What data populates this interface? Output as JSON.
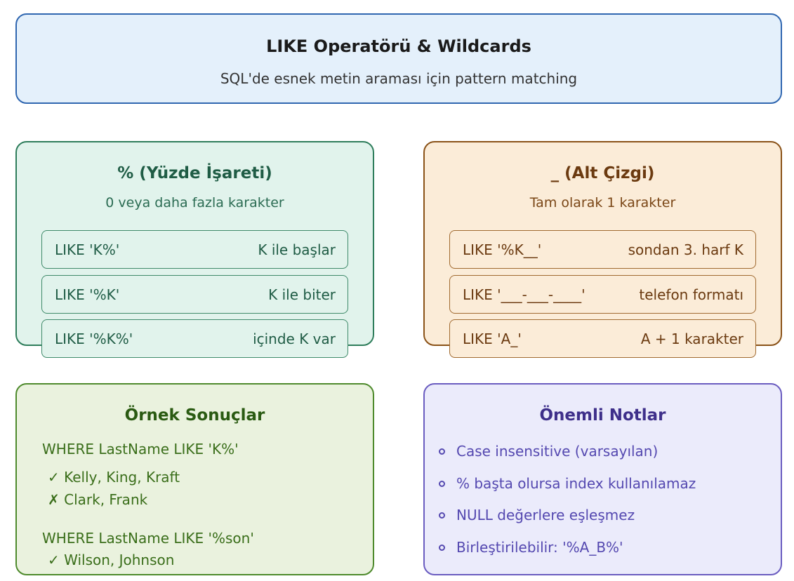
{
  "header": {
    "title": "LIKE Operatörü & Wildcards",
    "subtitle": "SQL'de esnek metin araması için pattern matching"
  },
  "percent": {
    "title": "% (Yüzde İşareti)",
    "subtitle": "0 veya daha fazla karakter",
    "rows": [
      {
        "code": "LIKE 'K%'",
        "desc": "K ile başlar"
      },
      {
        "code": "LIKE '%K'",
        "desc": "K ile biter"
      },
      {
        "code": "LIKE '%K%'",
        "desc": "içinde K var"
      }
    ]
  },
  "underscore": {
    "title": "_ (Alt Çizgi)",
    "subtitle": "Tam olarak 1 karakter",
    "rows": [
      {
        "code": "LIKE '%K__'",
        "desc": "sondan 3. harf K"
      },
      {
        "code": "LIKE '___-___-____'",
        "desc": "telefon formatı"
      },
      {
        "code": "LIKE 'A_'",
        "desc": "A + 1 karakter"
      }
    ]
  },
  "examples": {
    "title": "Örnek Sonuçlar",
    "query1": "WHERE LastName LIKE 'K%'",
    "match1": "✓ Kelly, King, Kraft",
    "nomatch1": "✗ Clark, Frank",
    "query2": "WHERE LastName LIKE '%son'",
    "match2": "✓ Wilson, Johnson"
  },
  "notes": {
    "title": "Önemli Notlar",
    "items": [
      "Case insensitive (varsayılan)",
      "% başta olursa index kullanılamaz",
      "NULL değerlere eşleşmez",
      "Birleştirilebilir: '%A_B%'"
    ]
  }
}
